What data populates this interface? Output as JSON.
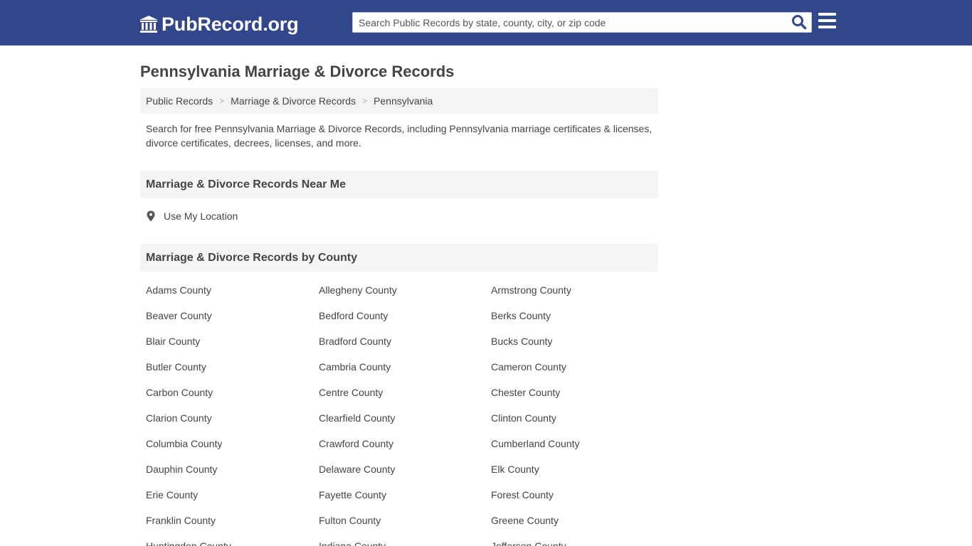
{
  "header": {
    "logo_text": "PubRecord.org",
    "search": {
      "value": "",
      "placeholder": "Search Public Records by state, county, city, or zip code"
    },
    "search_icon": "search-icon",
    "menu_icon": "hamburger-menu-icon",
    "logo_icon": "courthouse-icon",
    "background_color": "#32478b"
  },
  "page": {
    "title": "Pennsylvania Marriage & Divorce Records",
    "breadcrumb": [
      "Public Records",
      "Marriage & Divorce Records",
      "Pennsylvania"
    ],
    "intro": "Search for free Pennsylvania Marriage & Divorce Records, including Pennsylvania marriage certificates & licenses, divorce certificates, decrees, licenses, and more."
  },
  "near_me": {
    "heading": "Marriage & Divorce Records Near Me",
    "location_link": "Use My Location",
    "location_icon": "map-pin-icon"
  },
  "by_county": {
    "heading": "Marriage & Divorce Records by County",
    "counties": [
      "Adams County",
      "Allegheny County",
      "Armstrong County",
      "Beaver County",
      "Bedford County",
      "Berks County",
      "Blair County",
      "Bradford County",
      "Bucks County",
      "Butler County",
      "Cambria County",
      "Cameron County",
      "Carbon County",
      "Centre County",
      "Chester County",
      "Clarion County",
      "Clearfield County",
      "Clinton County",
      "Columbia County",
      "Crawford County",
      "Cumberland County",
      "Dauphin County",
      "Delaware County",
      "Elk County",
      "Erie County",
      "Fayette County",
      "Forest County",
      "Franklin County",
      "Fulton County",
      "Greene County",
      "Huntingdon County",
      "Indiana County",
      "Jefferson County"
    ]
  }
}
